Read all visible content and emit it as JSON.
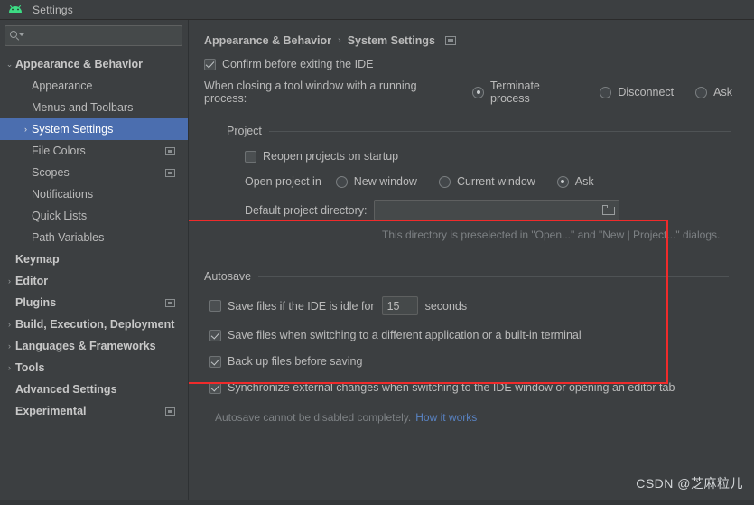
{
  "window": {
    "title": "Settings",
    "app_icon": "android-icon"
  },
  "search": {
    "value": "",
    "placeholder": "",
    "icon": "search-icon"
  },
  "sidebar": {
    "items": [
      {
        "label": "Appearance & Behavior",
        "arrow": "⌄",
        "expanded": true,
        "bold": true,
        "indent": 0,
        "selected": false,
        "badge": false
      },
      {
        "label": "Appearance",
        "arrow": "",
        "bold": false,
        "indent": 1,
        "selected": false,
        "badge": false
      },
      {
        "label": "Menus and Toolbars",
        "arrow": "",
        "bold": false,
        "indent": 1,
        "selected": false,
        "badge": false
      },
      {
        "label": "System Settings",
        "arrow": "›",
        "bold": false,
        "indent": 1,
        "selected": true,
        "badge": false
      },
      {
        "label": "File Colors",
        "arrow": "",
        "bold": false,
        "indent": 1,
        "selected": false,
        "badge": true
      },
      {
        "label": "Scopes",
        "arrow": "",
        "bold": false,
        "indent": 1,
        "selected": false,
        "badge": true
      },
      {
        "label": "Notifications",
        "arrow": "",
        "bold": false,
        "indent": 1,
        "selected": false,
        "badge": false
      },
      {
        "label": "Quick Lists",
        "arrow": "",
        "bold": false,
        "indent": 1,
        "selected": false,
        "badge": false
      },
      {
        "label": "Path Variables",
        "arrow": "",
        "bold": false,
        "indent": 1,
        "selected": false,
        "badge": false
      },
      {
        "label": "Keymap",
        "arrow": "",
        "bold": true,
        "indent": 0,
        "selected": false,
        "badge": false
      },
      {
        "label": "Editor",
        "arrow": "›",
        "bold": true,
        "indent": 0,
        "selected": false,
        "badge": false
      },
      {
        "label": "Plugins",
        "arrow": "",
        "bold": true,
        "indent": 0,
        "selected": false,
        "badge": true
      },
      {
        "label": "Build, Execution, Deployment",
        "arrow": "›",
        "bold": true,
        "indent": 0,
        "selected": false,
        "badge": false
      },
      {
        "label": "Languages & Frameworks",
        "arrow": "›",
        "bold": true,
        "indent": 0,
        "selected": false,
        "badge": false
      },
      {
        "label": "Tools",
        "arrow": "›",
        "bold": true,
        "indent": 0,
        "selected": false,
        "badge": false
      },
      {
        "label": "Advanced Settings",
        "arrow": "",
        "bold": true,
        "indent": 0,
        "selected": false,
        "badge": false
      },
      {
        "label": "Experimental",
        "arrow": "",
        "bold": true,
        "indent": 0,
        "selected": false,
        "badge": true
      }
    ]
  },
  "breadcrumb": {
    "parent": "Appearance & Behavior",
    "separator": "›",
    "current": "System Settings",
    "modified_icon": "modified-marker-icon"
  },
  "main": {
    "confirm_exit": {
      "label": "Confirm before exiting the IDE",
      "checked": true
    },
    "closing_tool_window": {
      "label": "When closing a tool window with a running process:",
      "options": [
        {
          "label": "Terminate process",
          "selected": true
        },
        {
          "label": "Disconnect",
          "selected": false
        },
        {
          "label": "Ask",
          "selected": false
        }
      ]
    },
    "project_group": {
      "title": "Project",
      "reopen_on_startup": {
        "label": "Reopen projects on startup",
        "checked": false
      },
      "open_project_in": {
        "label": "Open project in",
        "options": [
          {
            "label": "New window",
            "selected": false
          },
          {
            "label": "Current window",
            "selected": false
          },
          {
            "label": "Ask",
            "selected": true
          }
        ]
      },
      "default_directory": {
        "label": "Default project directory:",
        "value": "",
        "placeholder": "",
        "browse_icon": "folder-icon"
      },
      "hint": "This directory is preselected in \"Open...\" and \"New | Project...\" dialogs."
    },
    "autosave_group": {
      "title": "Autosave",
      "idle_save": {
        "label_before": "Save files if the IDE is idle for",
        "value": "15",
        "label_after": "seconds",
        "checked": false
      },
      "checkboxes": [
        {
          "label": "Save files when switching to a different application or a built-in terminal",
          "checked": true
        },
        {
          "label": "Back up files before saving",
          "checked": true
        },
        {
          "label": "Synchronize external changes when switching to the IDE window or opening an editor tab",
          "checked": true
        }
      ],
      "note_text": "Autosave cannot be disabled completely.",
      "note_link": "How it works"
    }
  },
  "annotation": {
    "color": "#f02b2b"
  },
  "watermark": {
    "text": "CSDN @芝麻粒儿"
  },
  "colors": {
    "background": "#3c3f41",
    "selection": "#4b6eaf",
    "link": "#5983c4",
    "text": "#bbbbbb",
    "muted": "#7d8184",
    "annotation": "#f02b2b"
  }
}
